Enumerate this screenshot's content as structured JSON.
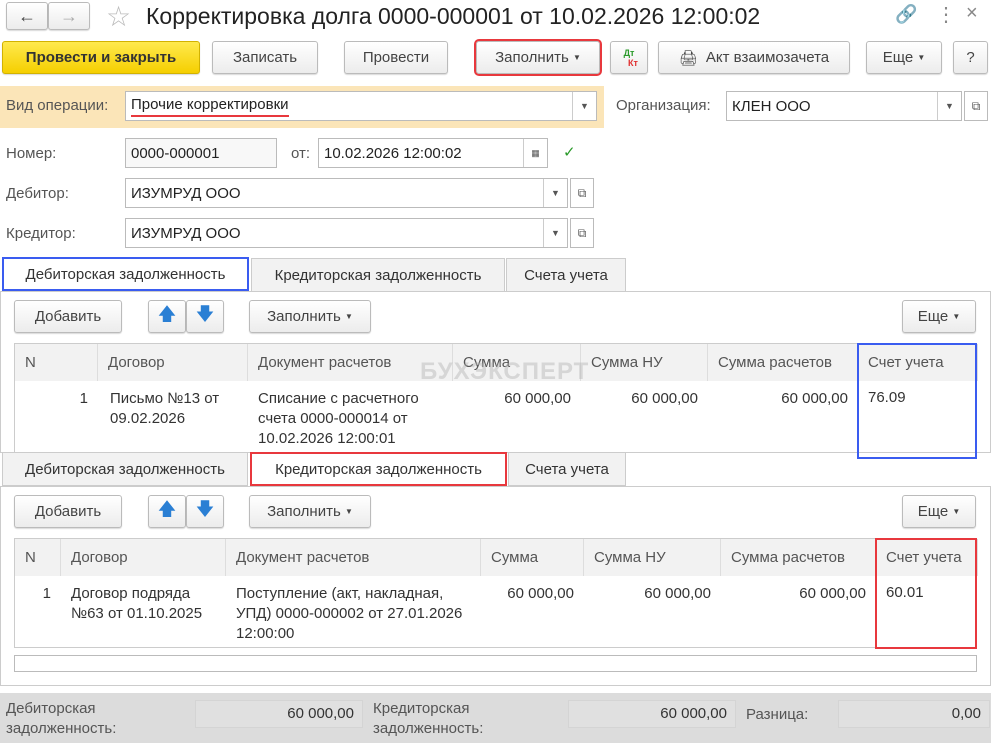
{
  "title": "Корректировка долга 0000-000001 от 10.02.2026 12:00:02",
  "toolbar": {
    "post_close": "Провести и закрыть",
    "save": "Записать",
    "post": "Провести",
    "fill": "Заполнить",
    "dtkt_dt": "Дт",
    "dtkt_kt": "Кт",
    "act": "Акт взаимозачета",
    "more": "Еще",
    "help": "?"
  },
  "form": {
    "op_label": "Вид операции:",
    "op_value": "Прочие корректировки",
    "org_label": "Организация:",
    "org_value": "КЛЕН ООО",
    "num_label": "Номер:",
    "num_value": "0000-000001",
    "from_label": "от:",
    "date_value": "10.02.2026 12:00:02",
    "debtor_label": "Дебитор:",
    "debtor_value": "ИЗУМРУД ООО",
    "creditor_label": "Кредитор:",
    "creditor_value": "ИЗУМРУД ООО"
  },
  "tabs": [
    "Дебиторская задолженность",
    "Кредиторская задолженность",
    "Счета учета"
  ],
  "panel": {
    "add": "Добавить",
    "fill": "Заполнить",
    "more": "Еще"
  },
  "columns": [
    "N",
    "Договор",
    "Документ расчетов",
    "Сумма",
    "Сумма НУ",
    "Сумма расчетов",
    "Счет учета"
  ],
  "debit_rows": [
    {
      "n": "1",
      "contract": "Письмо №13 от 09.02.2026",
      "doc": "Списание с расчетного счета 0000-000014 от 10.02.2026 12:00:01",
      "sum": "60 000,00",
      "sum_nu": "60 000,00",
      "sum_calc": "60 000,00",
      "account": "76.09"
    }
  ],
  "credit_rows": [
    {
      "n": "1",
      "contract": "Договор подряда №63 от 01.10.2025",
      "doc": "Поступление (акт, накладная, УПД) 0000-000002 от 27.01.2026 12:00:00",
      "sum": "60 000,00",
      "sum_nu": "60 000,00",
      "sum_calc": "60 000,00",
      "account": "60.01"
    }
  ],
  "watermark": "БУХЭКСПЕРТ",
  "footer": {
    "debit_label": "Дебиторская задолженность:",
    "debit_value": "60 000,00",
    "credit_label": "Кредиторская задолженность:",
    "credit_value": "60 000,00",
    "diff_label": "Разница:",
    "diff_value": "0,00"
  }
}
